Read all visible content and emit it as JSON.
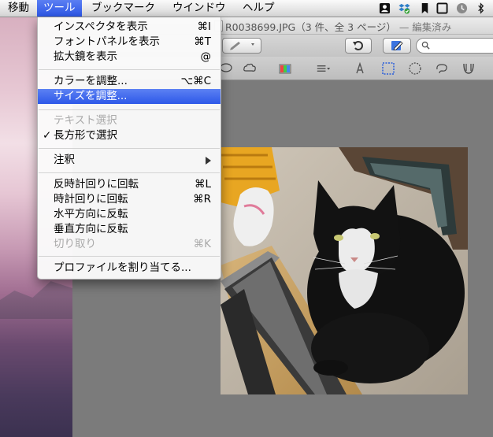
{
  "menubar": {
    "items": [
      "移動",
      "ツール",
      "ブックマーク",
      "ウインドウ",
      "ヘルプ"
    ],
    "active_index": 1,
    "status_icons": [
      "contacts-icon",
      "dropbox-icon",
      "bookmark-icon",
      "window-icon",
      "time-machine-icon",
      "bluetooth-icon"
    ]
  },
  "window": {
    "title": "R0038699.JPG（3 件、全 3 ページ）",
    "edited_label": "— 編集済み"
  },
  "menu": {
    "items": [
      {
        "label": "インスペクタを表示",
        "shortcut": "⌘I"
      },
      {
        "label": "フォントパネルを表示",
        "shortcut": "⌘T"
      },
      {
        "label": "拡大鏡を表示",
        "shortcut": "@"
      },
      {
        "label": "カラーを調整...",
        "shortcut": "⌥⌘C"
      },
      {
        "label": "サイズを調整...",
        "shortcut": ""
      },
      {
        "label": "テキスト選択",
        "shortcut": ""
      },
      {
        "label": "長方形で選択",
        "shortcut": "",
        "check": "✓"
      },
      {
        "label": "注釈",
        "shortcut": ""
      },
      {
        "label": "反時計回りに回転",
        "shortcut": "⌘L"
      },
      {
        "label": "時計回りに回転",
        "shortcut": "⌘R"
      },
      {
        "label": "水平方向に反転",
        "shortcut": ""
      },
      {
        "label": "垂直方向に反転",
        "shortcut": ""
      },
      {
        "label": "切り取り",
        "shortcut": "⌘K"
      },
      {
        "label": "プロファイルを割り当てる...",
        "shortcut": ""
      }
    ]
  },
  "colors": {
    "highlight": "#2d58e8",
    "background": "#7b7b7b"
  }
}
